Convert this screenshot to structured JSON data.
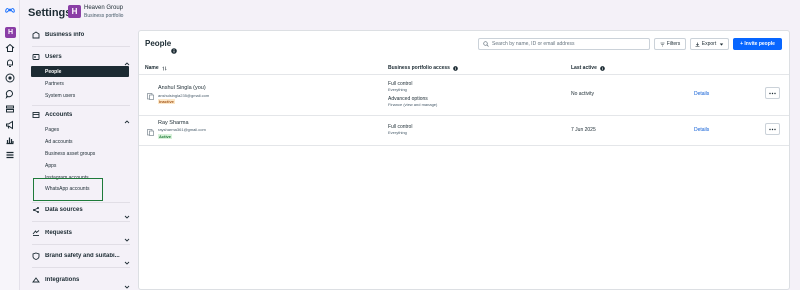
{
  "rail": {
    "logo_icon": "meta-logo-icon",
    "avatar_letter": "H",
    "icons": [
      "home-icon",
      "bell-icon",
      "circle-plus-icon",
      "chat-icon",
      "stack-icon",
      "megaphone-icon",
      "bar-chart-icon",
      "menu-icon"
    ]
  },
  "header": {
    "title": "Settings",
    "business_avatar": "H",
    "business_name": "Heaven Group",
    "business_sub": "Business portfolio"
  },
  "nav": {
    "business_info": "Business info",
    "users": "Users",
    "users_items": [
      "People",
      "Partners",
      "System users"
    ],
    "accounts": "Accounts",
    "accounts_items": [
      "Pages",
      "Ad accounts",
      "Business asset groups",
      "Apps",
      "Instagram accounts",
      "WhatsApp accounts"
    ],
    "data_sources": "Data sources",
    "requests": "Requests",
    "brand_safety": "Brand safety and suitabi...",
    "integrations": "Integrations"
  },
  "main": {
    "title": "People",
    "search_placeholder": "Search by name, ID or email address",
    "filters_label": "Filters",
    "export_label": "Export",
    "invite_label": "+ Invite people",
    "columns": {
      "name": "Name",
      "access": "Business portfolio access",
      "last_active": "Last active"
    },
    "rows": [
      {
        "name": "Anshul Singla (you)",
        "email": "anshulsingla235@gmail.com",
        "status": "Inactive",
        "access1": "Full control",
        "access1_sub": "Everything",
        "access2": "Advanced options",
        "access2_sub": "Finance (view and manage)",
        "last_active": "No activity",
        "details": "Details"
      },
      {
        "name": "Ray Sharma",
        "email": "raysharma361@gmail.com",
        "status": "Active",
        "access1": "Full control",
        "access1_sub": "Everything",
        "last_active": "7 Jun 2025",
        "details": "Details"
      }
    ]
  },
  "colors": {
    "accent": "#0866ff",
    "avatar": "#8a3ea6",
    "active_nav": "#1c2b33",
    "highlight_box": "#1e7a3a",
    "inactive_badge": "#a4561b",
    "active_badge": "#1d7a34"
  }
}
